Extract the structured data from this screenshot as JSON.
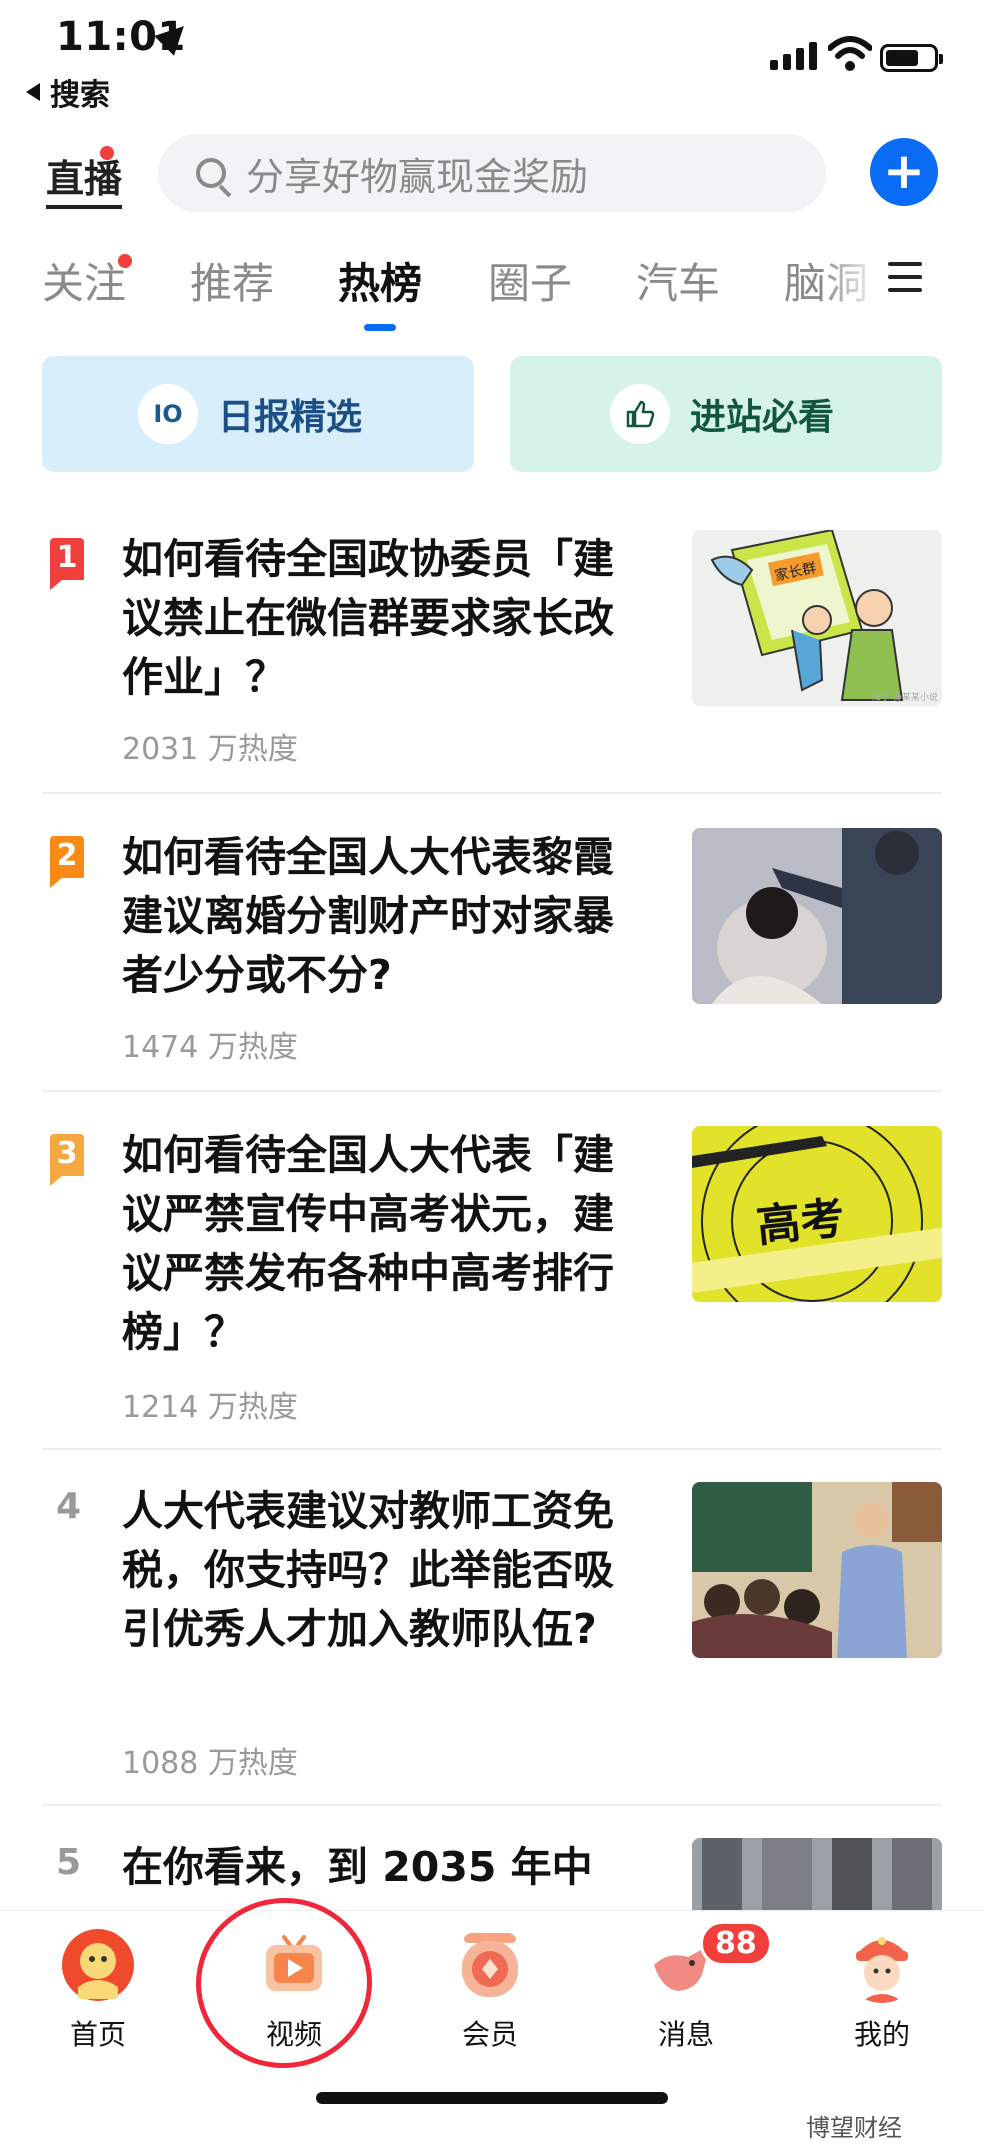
{
  "status_bar": {
    "time": "11:01",
    "back_label": "搜索",
    "battery_level": 0.7
  },
  "header": {
    "logo": "直播",
    "search_placeholder": "分享好物赢现金奖励",
    "add_label": "+"
  },
  "tabs": [
    {
      "label": "关注"
    },
    {
      "label": "推荐"
    },
    {
      "label": "热榜"
    },
    {
      "label": "圈子"
    },
    {
      "label": "汽车"
    },
    {
      "label": "脑洞"
    }
  ],
  "active_tab": "热榜",
  "quick_cards": [
    {
      "icon": "IO",
      "label": "日报精选"
    },
    {
      "icon": "thumbs-up-icon",
      "label": "进站必看"
    }
  ],
  "feed": [
    {
      "rank": "1",
      "title": "如何看待全国政协委员「建议禁止在微信群要求家长改作业」？",
      "heat": "2031 万热度",
      "thumb_text": "家长群",
      "thumb_caption": "知乎 @某某小说"
    },
    {
      "rank": "2",
      "title": "如何看待全国人大代表黎霞建议离婚分割财产时对家暴者少分或不分?",
      "heat": "1474 万热度"
    },
    {
      "rank": "3",
      "title": "如何看待全国人大代表「建议严禁宣传中高考状元，建议严禁发布各种中高考排行榜」？",
      "heat": "1214 万热度",
      "thumb_text": "高考"
    },
    {
      "rank": "4",
      "title": "人大代表建议对教师工资免税，你支持吗？此举能否吸引优秀人才加入教师队伍?",
      "heat": "1088 万热度"
    },
    {
      "rank": "5",
      "title": "在你看来，到 2035 年中",
      "heat": ""
    }
  ],
  "bottom_nav": [
    {
      "label": "首页",
      "icon": "home-mascot-icon"
    },
    {
      "label": "视频",
      "icon": "video-tv-icon"
    },
    {
      "label": "会员",
      "icon": "member-badge-icon"
    },
    {
      "label": "消息",
      "icon": "bird-message-icon",
      "badge": "88"
    },
    {
      "label": "我的",
      "icon": "profile-mascot-icon"
    }
  ],
  "watermark": "博望财经",
  "colors": {
    "accent": "#0a6cf5",
    "rank1": "#f1403c",
    "rank2": "#f98a16",
    "rank3": "#f5a742",
    "annotation": "#f0263a"
  }
}
